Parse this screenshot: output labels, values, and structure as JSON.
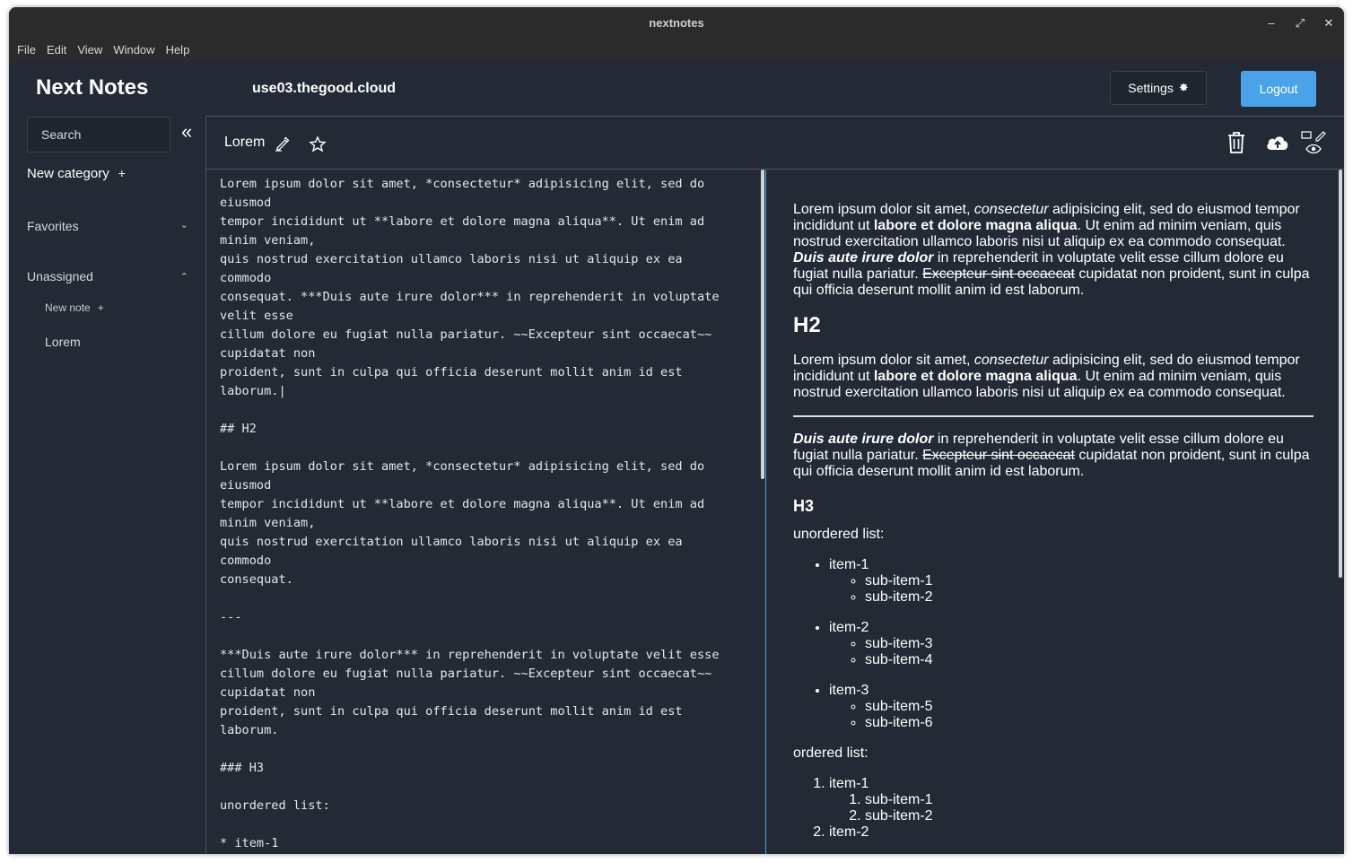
{
  "window": {
    "title": "nextnotes"
  },
  "menu": [
    "File",
    "Edit",
    "View",
    "Window",
    "Help"
  ],
  "header": {
    "brand": "Next Notes",
    "server": "use03.thegood.cloud",
    "settings_label": "Settings",
    "logout_label": "Logout"
  },
  "sidebar": {
    "search_placeholder": "Search",
    "new_category": "New category",
    "favorites": "Favorites",
    "unassigned": "Unassigned",
    "new_note": "New note",
    "notes": [
      "Lorem"
    ]
  },
  "note": {
    "title": "Lorem"
  },
  "editor": {
    "text": "Lorem ipsum dolor sit amet, *consectetur* adipisicing elit, sed do\neiusmod\ntempor incididunt ut **labore et dolore magna aliqua**. Ut enim ad\nminim veniam,\nquis nostrud exercitation ullamco laboris nisi ut aliquip ex ea\ncommodo\nconsequat. ***Duis aute irure dolor*** in reprehenderit in voluptate\nvelit esse\ncillum dolore eu fugiat nulla pariatur. ~~Excepteur sint occaecat~~\ncupidatat non\nproident, sunt in culpa qui officia deserunt mollit anim id est\nlaborum.|\n\n## H2\n\nLorem ipsum dolor sit amet, *consectetur* adipisicing elit, sed do\neiusmod\ntempor incididunt ut **labore et dolore magna aliqua**. Ut enim ad\nminim veniam,\nquis nostrud exercitation ullamco laboris nisi ut aliquip ex ea\ncommodo\nconsequat.\n\n---\n\n***Duis aute irure dolor*** in reprehenderit in voluptate velit esse\ncillum dolore eu fugiat nulla pariatur. ~~Excepteur sint occaecat~~\ncupidatat non\nproident, sunt in culpa qui officia deserunt mollit anim id est\nlaborum.\n\n### H3\n\nunordered list:\n\n* item-1"
  },
  "preview": {
    "p1": {
      "a": "Lorem ipsum dolor sit amet, ",
      "em": "consectetur",
      "b": " adipisicing elit, sed do eiusmod tempor incididunt ut ",
      "strong": "labore et dolore magna aliqua",
      "c": ". Ut enim ad minim veniam, quis nostrud exercitation ullamco laboris nisi ut aliquip ex ea commodo consequat. ",
      "bi": "Duis aute irure dolor",
      "d": " in reprehenderit in voluptate velit esse cillum dolore eu fugiat nulla pariatur. ",
      "del": "Excepteur sint occaecat",
      "e": " cupidatat non proident, sunt in culpa qui officia deserunt mollit anim id est laborum."
    },
    "h2": "H2",
    "p2": {
      "a": "Lorem ipsum dolor sit amet, ",
      "em": "consectetur",
      "b": " adipisicing elit, sed do eiusmod tempor incididunt ut ",
      "strong": "labore et dolore magna aliqua",
      "c": ". Ut enim ad minim veniam, quis nostrud exercitation ullamco laboris nisi ut aliquip ex ea commodo consequat."
    },
    "p3": {
      "bi": "Duis aute irure dolor",
      "d": " in reprehenderit in voluptate velit esse cillum dolore eu fugiat nulla pariatur. ",
      "del": "Excepteur sint occaecat",
      "e": " cupidatat non proident, sunt in culpa qui officia deserunt mollit anim id est laborum."
    },
    "h3": "H3",
    "unordered_label": "unordered list:",
    "unordered": [
      {
        "item": "item-1",
        "subs": [
          "sub-item-1",
          "sub-item-2"
        ]
      },
      {
        "item": "item-2",
        "subs": [
          "sub-item-3",
          "sub-item-4"
        ]
      },
      {
        "item": "item-3",
        "subs": [
          "sub-item-5",
          "sub-item-6"
        ]
      }
    ],
    "ordered_label": "ordered list:",
    "ordered": [
      {
        "item": "item-1",
        "subs": [
          "sub-item-1",
          "sub-item-2"
        ]
      },
      {
        "item": "item-2",
        "subs": []
      }
    ]
  }
}
